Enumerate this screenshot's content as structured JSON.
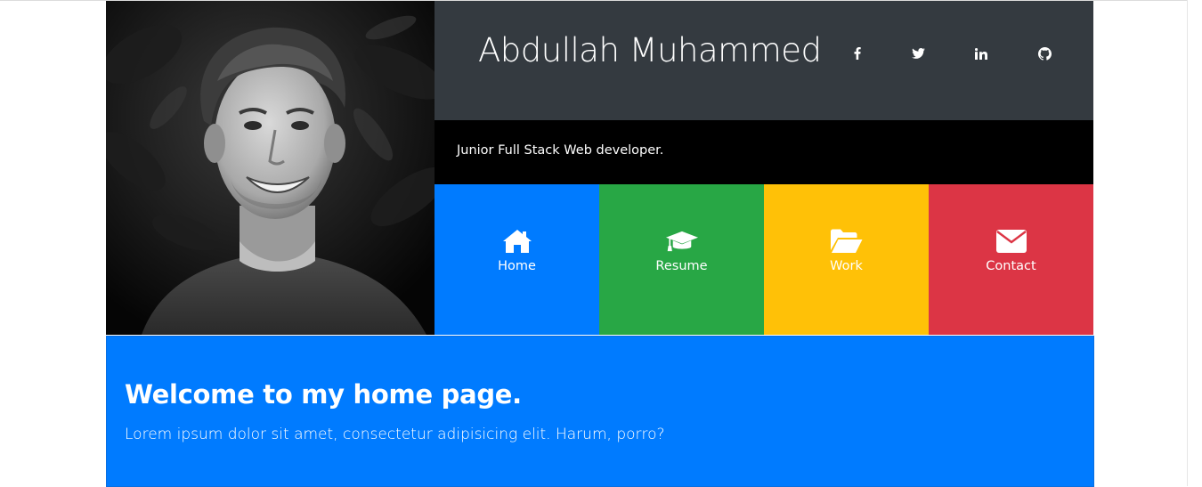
{
  "header": {
    "title": "Abdullah Muhammed",
    "tagline": "Junior Full Stack Web developer."
  },
  "social": [
    {
      "name": "facebook",
      "icon": "facebook-icon"
    },
    {
      "name": "twitter",
      "icon": "twitter-icon"
    },
    {
      "name": "linkedin",
      "icon": "linkedin-icon"
    },
    {
      "name": "github",
      "icon": "github-icon"
    }
  ],
  "nav": [
    {
      "label": "Home",
      "icon": "home-icon",
      "color": "#007bff"
    },
    {
      "label": "Resume",
      "icon": "graduation-cap-icon",
      "color": "#28a745"
    },
    {
      "label": "Work",
      "icon": "folder-open-icon",
      "color": "#ffc107"
    },
    {
      "label": "Contact",
      "icon": "envelope-icon",
      "color": "#dc3545"
    }
  ],
  "welcome": {
    "heading": "Welcome to my home page.",
    "text": "Lorem ipsum dolor sit amet, consectetur adipisicing elit. Harum, porro?"
  },
  "colors": {
    "header_bg": "#343a40",
    "tagline_bg": "#000000",
    "welcome_bg": "#007bff"
  }
}
